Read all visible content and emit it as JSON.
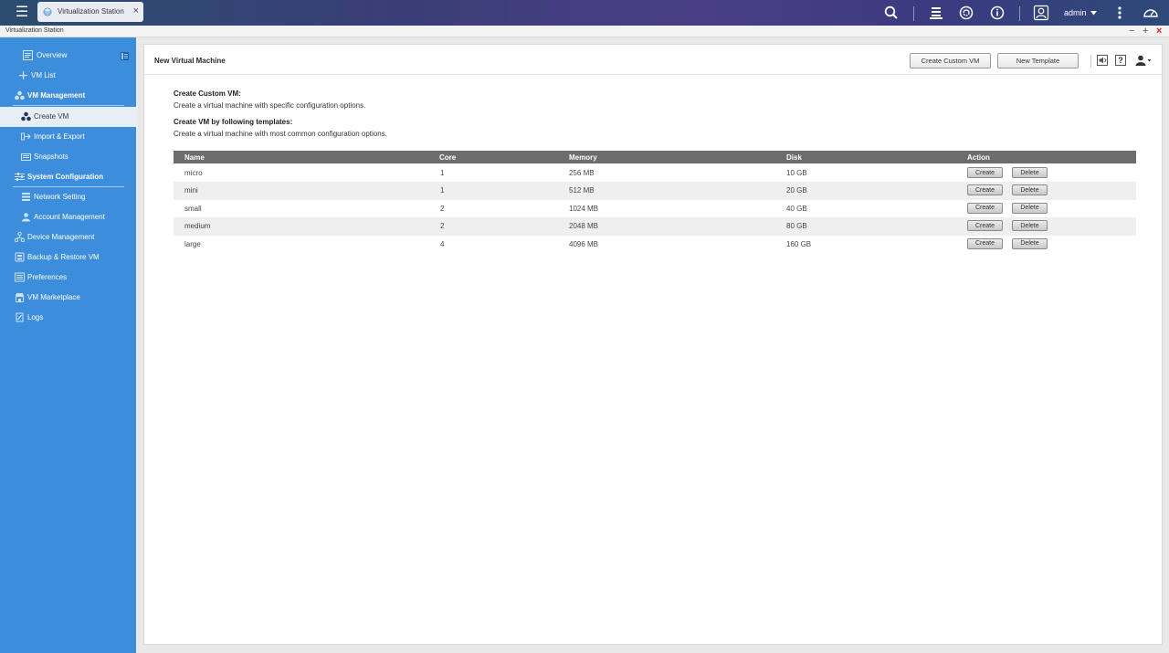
{
  "topbar": {
    "tab_label": "Virtualization Station",
    "user_label": "admin"
  },
  "window": {
    "title": "Virtualization Station"
  },
  "sidebar": {
    "items": [
      {
        "label": "Overview"
      },
      {
        "label": "VM List"
      },
      {
        "label": "VM Management"
      },
      {
        "label": "Create VM"
      },
      {
        "label": "Import & Export"
      },
      {
        "label": "Snapshots"
      },
      {
        "label": "System Configuration"
      },
      {
        "label": "Network Setting"
      },
      {
        "label": "Account Management"
      },
      {
        "label": "Device Management"
      },
      {
        "label": "Backup & Restore VM"
      },
      {
        "label": "Preferences"
      },
      {
        "label": "VM Marketplace"
      },
      {
        "label": "Logs"
      }
    ]
  },
  "main": {
    "title": "New Virtual Machine",
    "create_custom_label": "Create Custom VM",
    "new_template_label": "New Template",
    "help_glyph": "?",
    "custom_heading": "Create Custom VM:",
    "custom_text": "Create a virtual machine with specific configuration options.",
    "template_heading": "Create VM by following templates:",
    "template_text": "Create a virtual machine with most common configuration options."
  },
  "table": {
    "columns": [
      "Name",
      "Core",
      "Memory",
      "Disk",
      "Action"
    ],
    "create_label": "Create",
    "delete_label": "Delete",
    "rows": [
      {
        "name": "micro",
        "core": "1",
        "memory": "256 MB",
        "disk": "10 GB"
      },
      {
        "name": "mini",
        "core": "1",
        "memory": "512 MB",
        "disk": "20 GB"
      },
      {
        "name": "small",
        "core": "2",
        "memory": "1024 MB",
        "disk": "40 GB"
      },
      {
        "name": "medium",
        "core": "2",
        "memory": "2048 MB",
        "disk": "80 GB"
      },
      {
        "name": "large",
        "core": "4",
        "memory": "4096 MB",
        "disk": "160 GB"
      }
    ]
  },
  "colors": {
    "sidebar": "#3c8ddc",
    "table_header": "#6c6c6c",
    "close_red": "#d9262f"
  }
}
